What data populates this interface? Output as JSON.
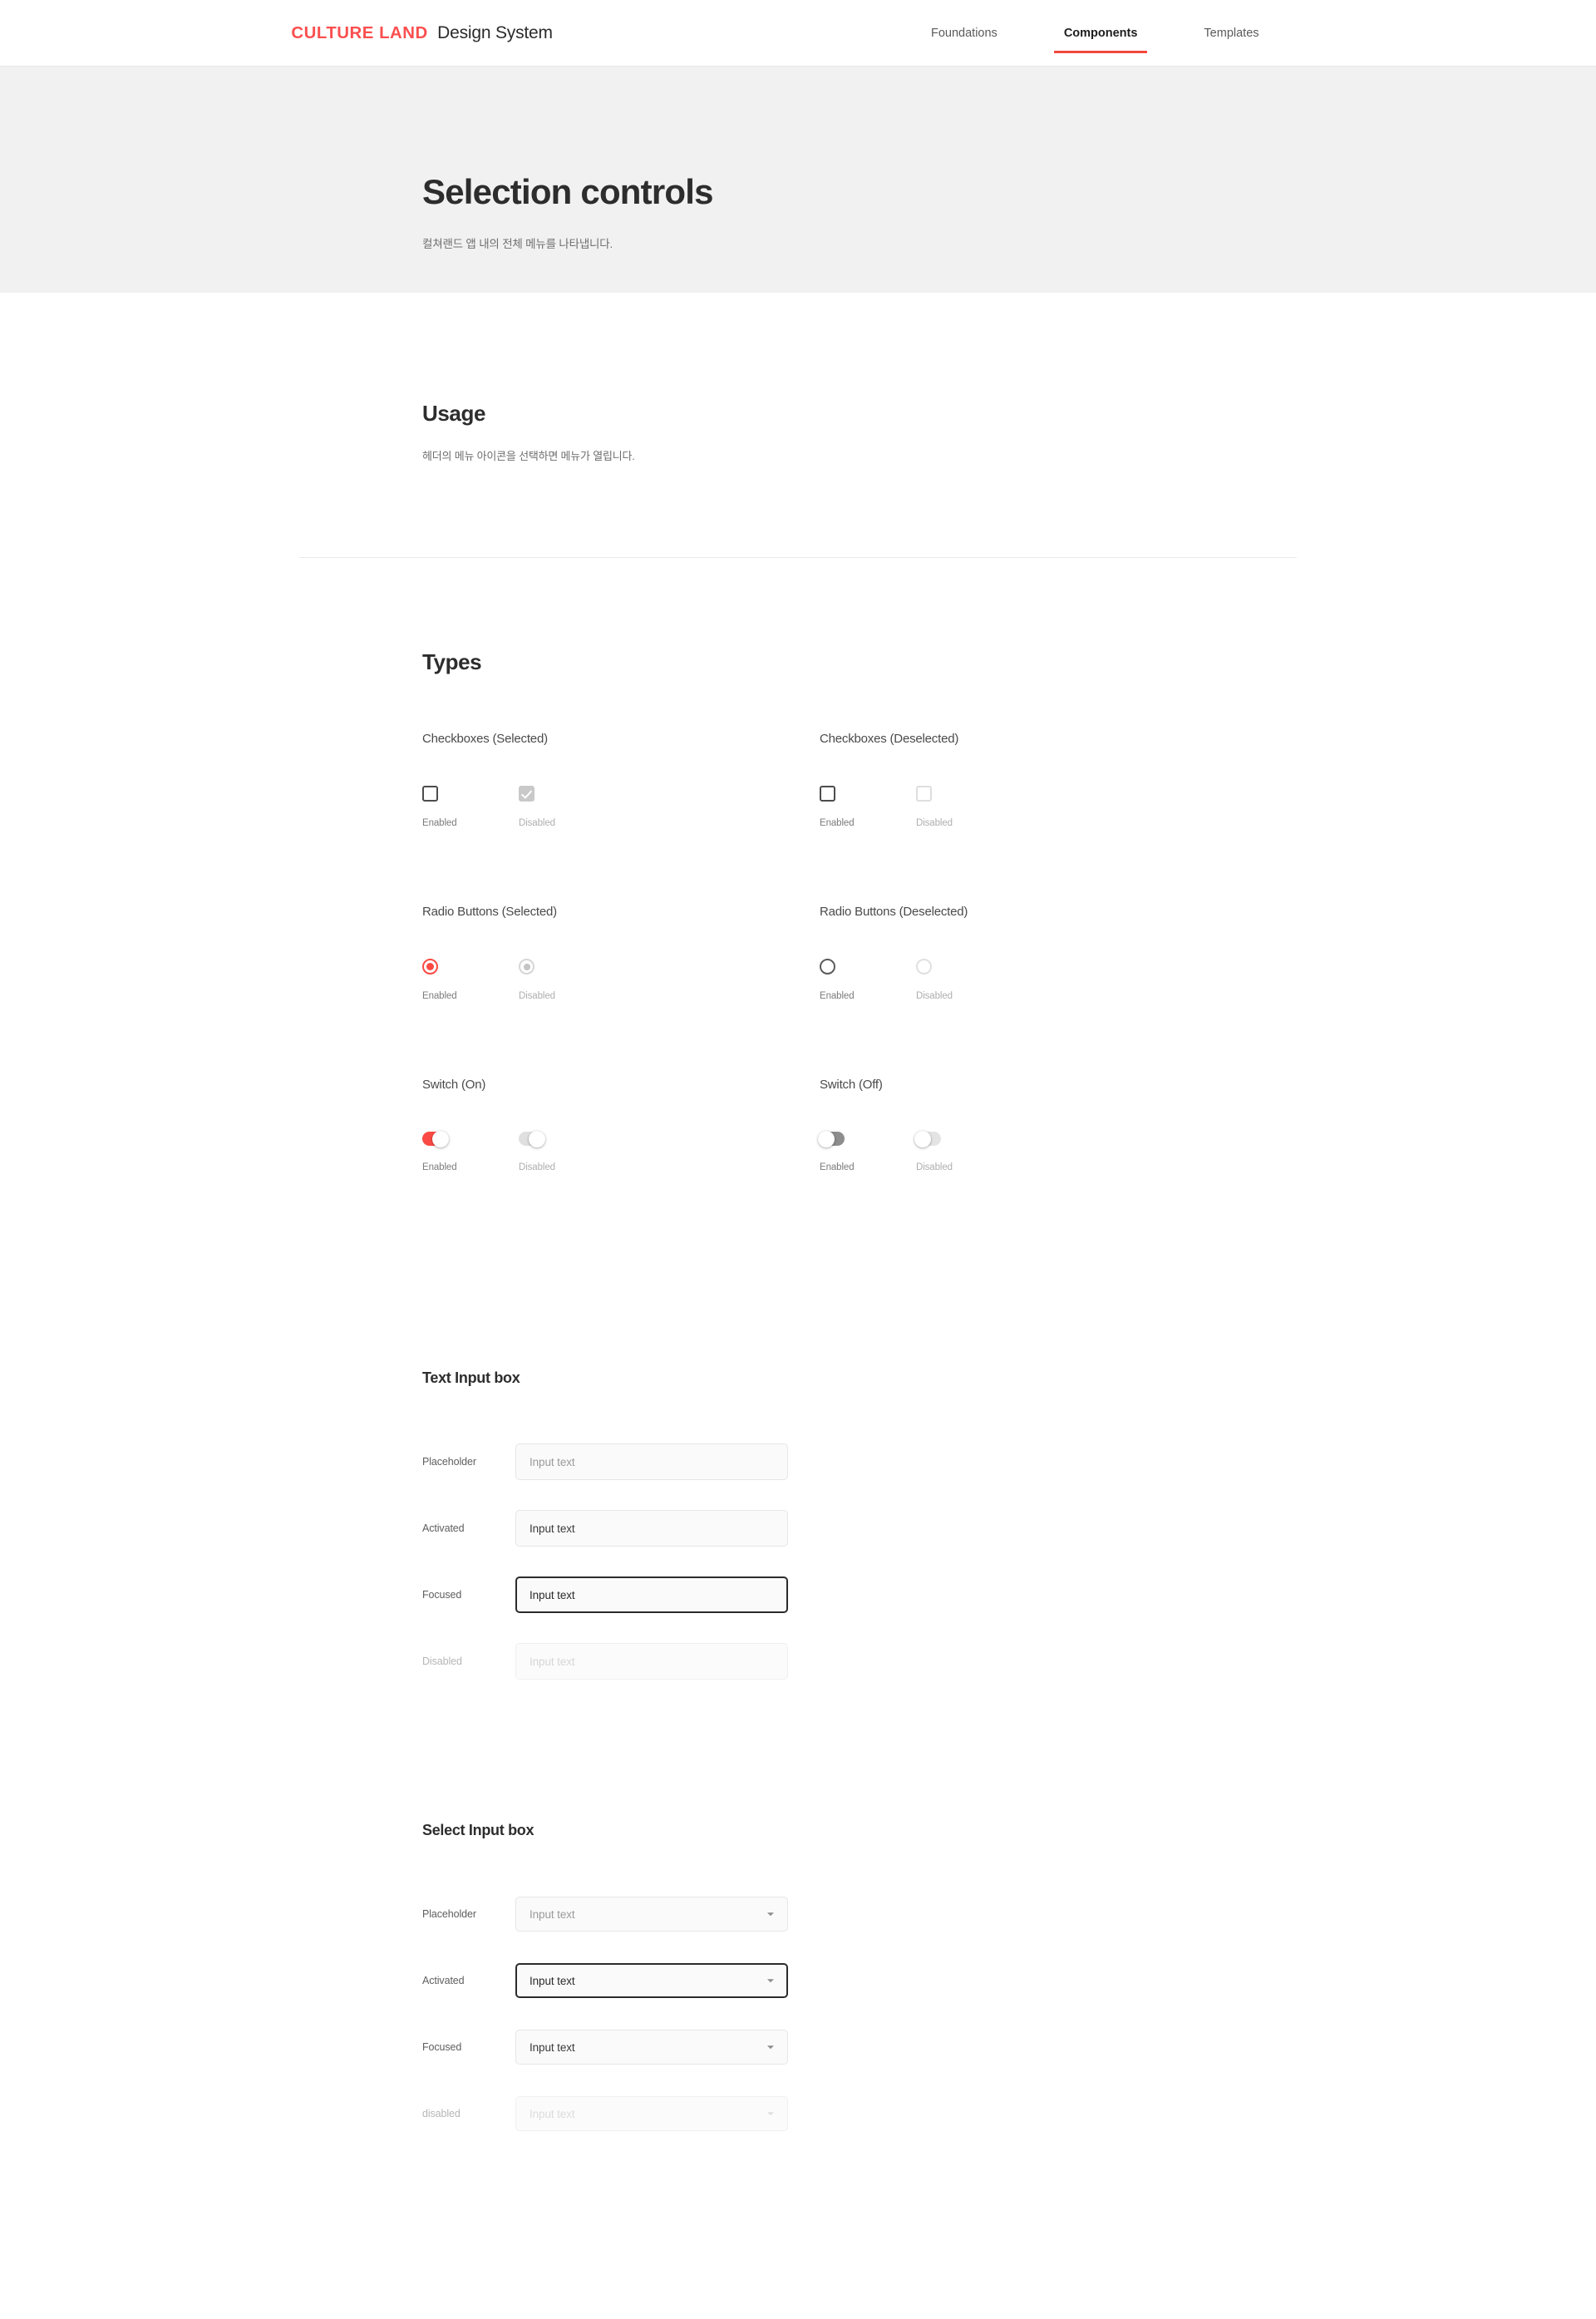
{
  "header": {
    "brand_logo": "CULTURE LAND",
    "brand_title": "Design System",
    "nav": [
      {
        "label": "Foundations",
        "active": false
      },
      {
        "label": "Components",
        "active": true
      },
      {
        "label": "Templates",
        "active": false
      }
    ]
  },
  "hero": {
    "title": "Selection controls",
    "subtitle": "컬쳐랜드 앱 내의 전체 메뉴를 나타냅니다."
  },
  "usage": {
    "heading": "Usage",
    "description": "헤더의 메뉴 아이콘을 선택하면 메뉴가 열립니다."
  },
  "types": {
    "heading": "Types",
    "groups": [
      {
        "label": "Checkboxes (Selected)",
        "items": [
          {
            "state": "Enabled",
            "variant": "checkbox-enabled-empty"
          },
          {
            "state": "Disabled",
            "variant": "checkbox-checked-disabled"
          }
        ]
      },
      {
        "label": "Checkboxes (Deselected)",
        "items": [
          {
            "state": "Enabled",
            "variant": "checkbox-enabled-empty"
          },
          {
            "state": "Disabled",
            "variant": "checkbox-disabled-empty"
          }
        ]
      },
      {
        "label": "Radio Buttons (Selected)",
        "items": [
          {
            "state": "Enabled",
            "variant": "radio-selected-enabled"
          },
          {
            "state": "Disabled",
            "variant": "radio-selected-disabled"
          }
        ]
      },
      {
        "label": "Radio Buttons (Deselected)",
        "items": [
          {
            "state": "Enabled",
            "variant": "radio-deselected-enabled"
          },
          {
            "state": "Disabled",
            "variant": "radio-deselected-disabled"
          }
        ]
      },
      {
        "label": "Switch (On)",
        "items": [
          {
            "state": "Enabled",
            "variant": "switch-on-enabled"
          },
          {
            "state": "Disabled",
            "variant": "switch-on-disabled"
          }
        ]
      },
      {
        "label": "Switch (Off)",
        "items": [
          {
            "state": "Enabled",
            "variant": "switch-off-enabled"
          },
          {
            "state": "Disabled",
            "variant": "switch-off-disabled"
          }
        ]
      }
    ]
  },
  "text_input": {
    "heading": "Text Input box",
    "fields": [
      {
        "label": "Placeholder",
        "value": "Input text",
        "placeholder": "Input text"
      },
      {
        "label": "Activated",
        "value": "Input text",
        "placeholder": "Input text"
      },
      {
        "label": "Focused",
        "value": "Input text",
        "placeholder": "Input text"
      },
      {
        "label": "Disabled",
        "value": "Input text",
        "placeholder": "Input text"
      }
    ]
  },
  "select_input": {
    "heading": "Select Input box",
    "fields": [
      {
        "label": "Placeholder",
        "value": "Input text"
      },
      {
        "label": "Activated",
        "value": "Input text"
      },
      {
        "label": "Focused",
        "value": "Input text"
      },
      {
        "label": "disabled",
        "value": "Input text"
      }
    ]
  },
  "colors": {
    "accent_red": "#fb4a43",
    "nav_underline": "#f4493c",
    "hero_background": "#f1f1f1",
    "text_primary": "#2d2d2d",
    "text_secondary": "#6e6e6e"
  }
}
